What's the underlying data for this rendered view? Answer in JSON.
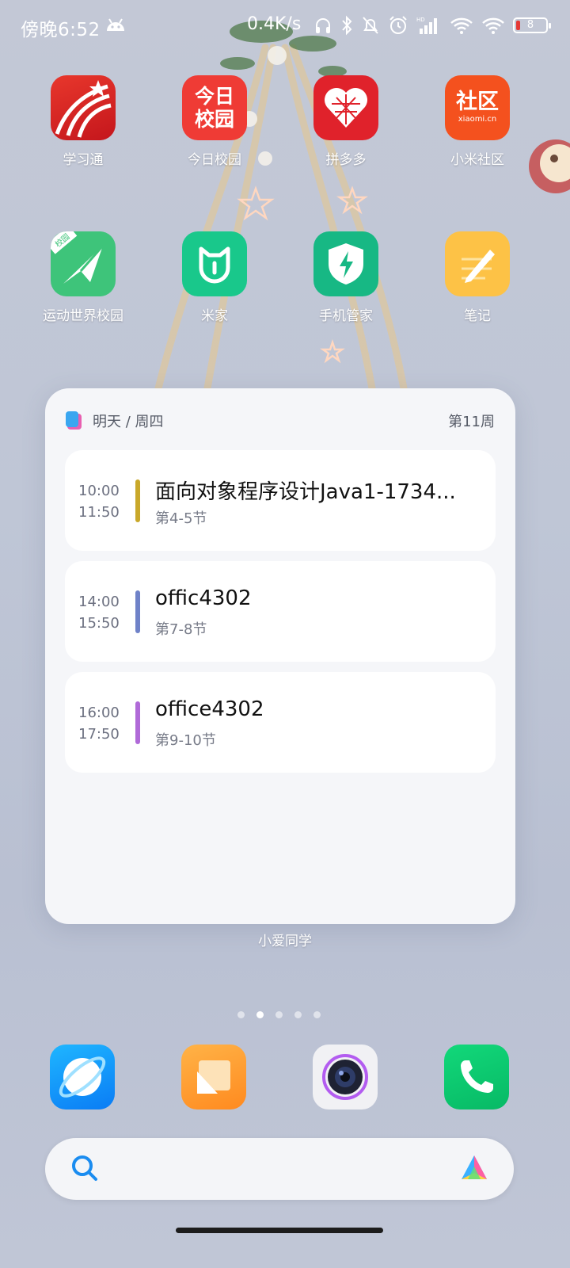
{
  "status_bar": {
    "time": "傍晚6:52",
    "net_speed": "0.4K/s",
    "battery_level": "8"
  },
  "apps_row1": [
    {
      "label": "学习通",
      "icon": "xuexitong-icon"
    },
    {
      "label": "今日校园",
      "icon": "jinrixiaoyuan-icon",
      "icon_text": "今日校园"
    },
    {
      "label": "拼多多",
      "icon": "pinduoduo-icon"
    },
    {
      "label": "小米社区",
      "icon": "xiaomi-community-icon",
      "icon_text": "社区",
      "icon_subtext": "xiaomi.cn"
    }
  ],
  "apps_row2": [
    {
      "label": "运动世界校园",
      "icon": "sports-world-icon",
      "icon_badge": "校园"
    },
    {
      "label": "米家",
      "icon": "mijia-icon"
    },
    {
      "label": "手机管家",
      "icon": "security-icon"
    },
    {
      "label": "笔记",
      "icon": "notes-icon"
    }
  ],
  "widget": {
    "date": "明天 / 周四",
    "week": "第11周",
    "caption": "小爱同学",
    "courses": [
      {
        "start": "10:00",
        "end": "11:50",
        "name": "面向对象程序设计Java1-1734...",
        "periods": "第4-5节",
        "color": "#c9a82a"
      },
      {
        "start": "14:00",
        "end": "15:50",
        "name": "offic4302",
        "periods": "第7-8节",
        "color": "#6f82c8"
      },
      {
        "start": "16:00",
        "end": "17:50",
        "name": "office4302",
        "periods": "第9-10节",
        "color": "#b06ad8"
      }
    ]
  },
  "page_indicator": {
    "count": 5,
    "active_index": 1
  },
  "dock": [
    {
      "icon": "browser-icon"
    },
    {
      "icon": "gallery-icon"
    },
    {
      "icon": "camera-icon"
    },
    {
      "icon": "phone-icon"
    }
  ]
}
